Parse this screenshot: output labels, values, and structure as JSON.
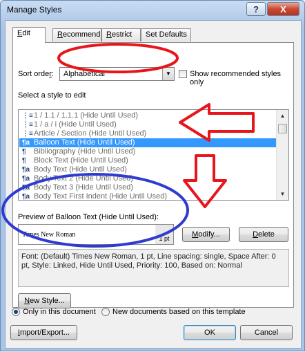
{
  "window": {
    "title": "Manage Styles",
    "help_glyph": "?",
    "close_glyph": "X"
  },
  "tabs": [
    {
      "label_u": "E",
      "label_rest": "dit",
      "active": true
    },
    {
      "label_u": "R",
      "label_rest": "ecommend",
      "active": false
    },
    {
      "label_u": "R",
      "label_rest": "estrict",
      "active": false
    },
    {
      "label_u": "",
      "label_rest": "Set Defaults",
      "active": false
    }
  ],
  "sort": {
    "label_pre": "Sort orde",
    "label_u": "r",
    "label_post": ":",
    "value": "Alphabetical",
    "show_recommended_label": "Show recommended styles only",
    "show_recommended_checked": false
  },
  "select_label": "Select a style to edit",
  "styles": [
    {
      "icon": "list-style-icon",
      "glyph": "⋮≡",
      "label": "1 / 1.1 / 1.1.1  (Hide Until Used)",
      "selected": false
    },
    {
      "icon": "list-style-icon",
      "glyph": "⋮≡",
      "label": "1 / a / i  (Hide Until Used)",
      "selected": false
    },
    {
      "icon": "list-style-icon",
      "glyph": "⋮≡",
      "label": "Article / Section  (Hide Until Used)",
      "selected": false
    },
    {
      "icon": "linked-style-icon",
      "glyph": "¶a",
      "label": "Balloon Text  (Hide Until Used)",
      "selected": true
    },
    {
      "icon": "paragraph-style-icon",
      "glyph": "¶",
      "label": "Bibliography  (Hide Until Used)",
      "selected": false
    },
    {
      "icon": "paragraph-style-icon",
      "glyph": "¶",
      "label": "Block Text  (Hide Until Used)",
      "selected": false
    },
    {
      "icon": "linked-style-icon",
      "glyph": "¶a",
      "label": "Body Text  (Hide Until Used)",
      "selected": false
    },
    {
      "icon": "linked-style-icon",
      "glyph": "¶a",
      "label": "Body Text 2  (Hide Until Used)",
      "selected": false
    },
    {
      "icon": "linked-style-icon",
      "glyph": "¶a",
      "label": "Body Text 3  (Hide Until Used)",
      "selected": false
    },
    {
      "icon": "linked-style-icon",
      "glyph": "¶a",
      "label": "Body Text First Indent  (Hide Until Used)",
      "selected": false
    }
  ],
  "preview": {
    "label": "Preview of Balloon Text  (Hide Until Used):",
    "font": "Times New Roman",
    "size": "1 pt"
  },
  "buttons": {
    "modify_u": "M",
    "modify_rest": "odify...",
    "delete_u": "D",
    "delete_rest": "elete",
    "new_style_u": "N",
    "new_style_rest": "ew Style...",
    "import_export_u": "I",
    "import_export_rest": "mport/Export...",
    "ok": "OK",
    "cancel": "Cancel"
  },
  "description": "Font: (Default) Times New Roman, 1 pt, Line spacing:  single, Space After:  0 pt, Style: Linked, Hide Until Used, Priority: 100, Based on: Normal",
  "scope": {
    "only_doc_label": "Only in this document",
    "only_doc_selected": true,
    "new_docs_label": "New documents based on this template",
    "new_docs_selected": false
  },
  "colors": {
    "annotation_red": "#e8151b",
    "annotation_blue": "#2f3bd0",
    "selection_blue": "#3399ff"
  }
}
